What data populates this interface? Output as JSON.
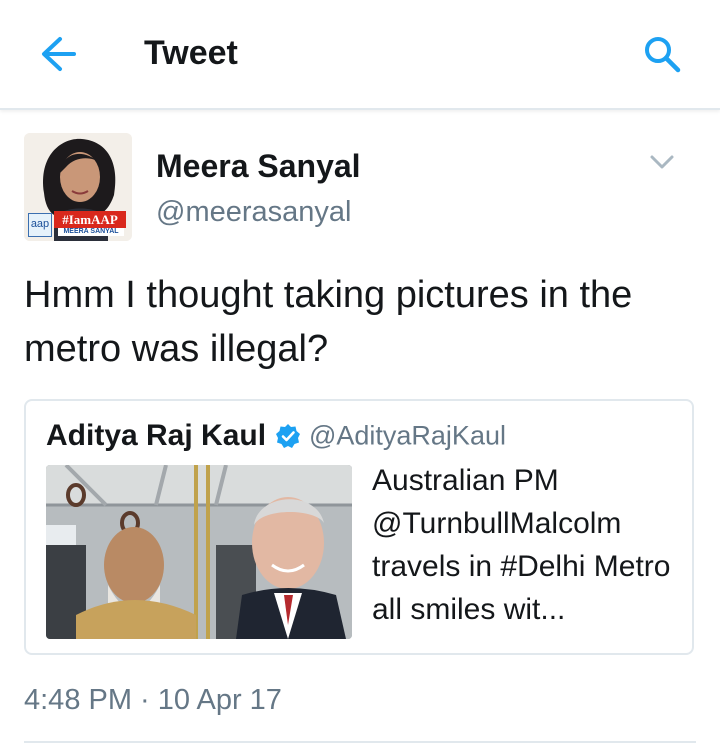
{
  "header": {
    "title": "Tweet",
    "back_icon": "arrow-left-icon",
    "search_icon": "search-icon",
    "accent_color": "#1da1f2"
  },
  "tweet": {
    "author_name": "Meera Sanyal",
    "author_handle": "@meerasanyal",
    "avatar_badge_small": "aap",
    "avatar_badge_tag": "#IamAAP",
    "avatar_badge_name": "MEERA SANYAL",
    "text": "Hmm I thought taking pictures in the metro was illegal?",
    "timestamp": "4:48 PM · 10 Apr 17",
    "menu_icon": "chevron-down-icon"
  },
  "quoted_tweet": {
    "author_name": "Aditya Raj Kaul",
    "author_handle": "@AdityaRajKaul",
    "verified_icon": "verified-badge-icon",
    "text": "Australian PM @TurnbullMalcolm travels in #Delhi Metro all smiles wit..."
  }
}
